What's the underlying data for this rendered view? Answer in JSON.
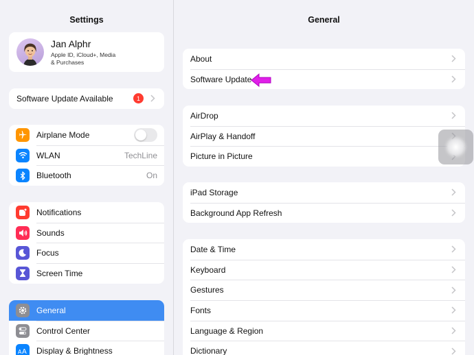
{
  "left": {
    "title": "Settings",
    "profile": {
      "name": "Jan Alphr",
      "subtitle_line1": "Apple ID, iCloud+, Media",
      "subtitle_line2": "& Purchases"
    },
    "update_row": {
      "label": "Software Update Available",
      "badge": "1"
    },
    "group1": [
      {
        "label": "Airplane Mode",
        "icon": "airplane-icon",
        "color": "#ff9500"
      },
      {
        "label": "WLAN",
        "value": "TechLine",
        "icon": "wifi-icon",
        "color": "#0a84ff"
      },
      {
        "label": "Bluetooth",
        "value": "On",
        "icon": "bluetooth-icon",
        "color": "#0a84ff"
      }
    ],
    "group2": [
      {
        "label": "Notifications",
        "icon": "bell-icon",
        "color": "#ff3b30"
      },
      {
        "label": "Sounds",
        "icon": "speaker-icon",
        "color": "#ff2d55"
      },
      {
        "label": "Focus",
        "icon": "moon-icon",
        "color": "#5856d6"
      },
      {
        "label": "Screen Time",
        "icon": "hourglass-icon",
        "color": "#5856d6"
      }
    ],
    "group3": [
      {
        "label": "General",
        "icon": "gear-icon",
        "color": "#8e8e93",
        "selected": true
      },
      {
        "label": "Control Center",
        "icon": "switches-icon",
        "color": "#8e8e93"
      },
      {
        "label": "Display & Brightness",
        "icon": "text-size-icon",
        "color": "#0a84ff"
      }
    ]
  },
  "right": {
    "title": "General",
    "group1": [
      {
        "label": "About"
      },
      {
        "label": "Software Update"
      }
    ],
    "group2": [
      {
        "label": "AirDrop"
      },
      {
        "label": "AirPlay & Handoff"
      },
      {
        "label": "Picture in Picture"
      }
    ],
    "group3": [
      {
        "label": "iPad Storage"
      },
      {
        "label": "Background App Refresh"
      }
    ],
    "group4": [
      {
        "label": "Date & Time"
      },
      {
        "label": "Keyboard"
      },
      {
        "label": "Gestures"
      },
      {
        "label": "Fonts"
      },
      {
        "label": "Language & Region"
      },
      {
        "label": "Dictionary"
      }
    ]
  },
  "colors": {
    "accent": "#3f8cf2",
    "badge": "#ff3b30",
    "annotation_arrow": "#e020e8"
  }
}
